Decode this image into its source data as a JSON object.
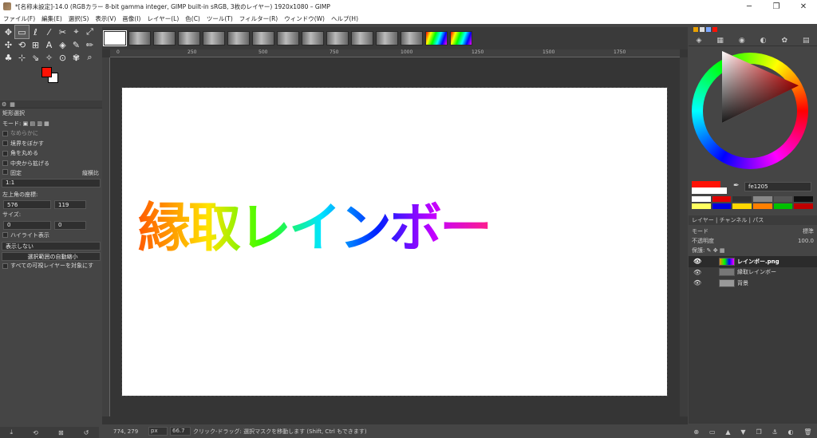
{
  "window": {
    "title": "*[名称未設定]-14.0 (RGBカラー 8-bit gamma integer, GIMP built-in sRGB, 3枚のレイヤー) 1920x1080 – GIMP",
    "controls": [
      "─",
      "❐",
      "✕"
    ]
  },
  "menubar": [
    "ファイル(F)",
    "編集(E)",
    "選択(S)",
    "表示(V)",
    "画像(I)",
    "レイヤー(L)",
    "色(C)",
    "ツール(T)",
    "フィルター(R)",
    "ウィンドウ(W)",
    "ヘルプ(H)"
  ],
  "toolbox": {
    "tools": [
      "✥",
      "▭",
      "ℓ",
      "⁄",
      "✂",
      "⌖",
      "⤢",
      "✣",
      "⟲",
      "⊞",
      "A",
      "◈",
      "✎",
      "✏",
      "♣",
      "⊹",
      "⇘",
      "✧",
      "⊙",
      "✾",
      "⌕"
    ],
    "fg_color": "#fe1205",
    "bg_color": "#ffffff",
    "options_title": "矩形選択",
    "mode_label": "モード:",
    "antialias": "なめらかに",
    "feather": "境界をぼかす",
    "rounded": "角を丸める",
    "expand_center": "中央から拡げる",
    "fixed_label": "固定",
    "fixed_value": "縦横比",
    "ratio": "1:1",
    "position_label": "左上角の座標:",
    "position_x": "576",
    "position_y": "119",
    "position_unit": "px",
    "size_label": "サイズ:",
    "size_w": "0",
    "size_h": "0",
    "size_unit": "px",
    "highlight": "ハイライト表示",
    "guides": "表示しない",
    "autoshrink": "選択範囲の自動縮小",
    "shrink_merged": "すべての可視レイヤーを対象にす"
  },
  "ruler": [
    "0",
    "250",
    "500",
    "750",
    "1000",
    "1250",
    "1500",
    "1750"
  ],
  "canvas": {
    "text": "縁取レインボー"
  },
  "status": {
    "coords": "774, 279",
    "unit": "px",
    "zoom": "66.7",
    "message": "クリック-ドラッグ: 選択マスクを移動します (Shift, Ctrl もできます)"
  },
  "right": {
    "hex": "fe1205",
    "tabs_label": "レイヤー",
    "channels_label": "チャンネル",
    "paths_label": "パス",
    "mode_label": "モード",
    "mode_value": "標準",
    "opacity_label": "不透明度",
    "opacity_value": "100.0",
    "lock_label": "保護:",
    "layers": [
      "レインボー.png",
      "縁取レインボー",
      "背景"
    ],
    "palette": [
      "#ffffff",
      "#e00000",
      "#333333",
      "#888888",
      "#555555",
      "#111111",
      "#ffff60",
      "#0000e0",
      "#ffd700",
      "#ff8000",
      "#00c000",
      "#c00000"
    ]
  }
}
